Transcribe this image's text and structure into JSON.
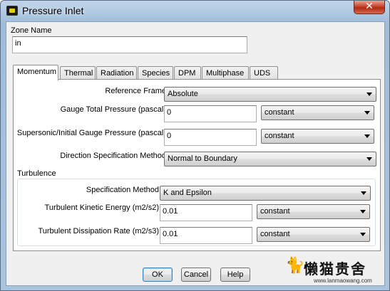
{
  "window": {
    "title": "Pressure Inlet",
    "close_symbol": "✕"
  },
  "zone": {
    "label": "Zone Name",
    "value": "in"
  },
  "tabs": [
    {
      "label": "Momentum"
    },
    {
      "label": "Thermal"
    },
    {
      "label": "Radiation"
    },
    {
      "label": "Species"
    },
    {
      "label": "DPM"
    },
    {
      "label": "Multiphase"
    },
    {
      "label": "UDS"
    }
  ],
  "momentum": {
    "reference_frame": {
      "label": "Reference Frame",
      "value": "Absolute"
    },
    "gauge_total_pressure": {
      "label": "Gauge Total Pressure (pascal)",
      "value": "0",
      "method": "constant"
    },
    "supersonic_pressure": {
      "label": "Supersonic/Initial Gauge Pressure (pascal)",
      "value": "0",
      "method": "constant"
    },
    "direction_method": {
      "label": "Direction Specification Method",
      "value": "Normal to Boundary"
    }
  },
  "turbulence": {
    "heading": "Turbulence",
    "spec_method": {
      "label": "Specification Method",
      "value": "K and Epsilon"
    },
    "kinetic_energy": {
      "label": "Turbulent Kinetic Energy (m2/s2)",
      "value": "0.01",
      "method": "constant"
    },
    "dissipation_rate": {
      "label": "Turbulent Dissipation Rate (m2/s3)",
      "value": "0.01",
      "method": "constant"
    }
  },
  "buttons": {
    "ok": "OK",
    "cancel": "Cancel",
    "help": "Help"
  },
  "watermark": {
    "text": "懒猫贵舍",
    "url": "www.lanmaowang.com"
  }
}
